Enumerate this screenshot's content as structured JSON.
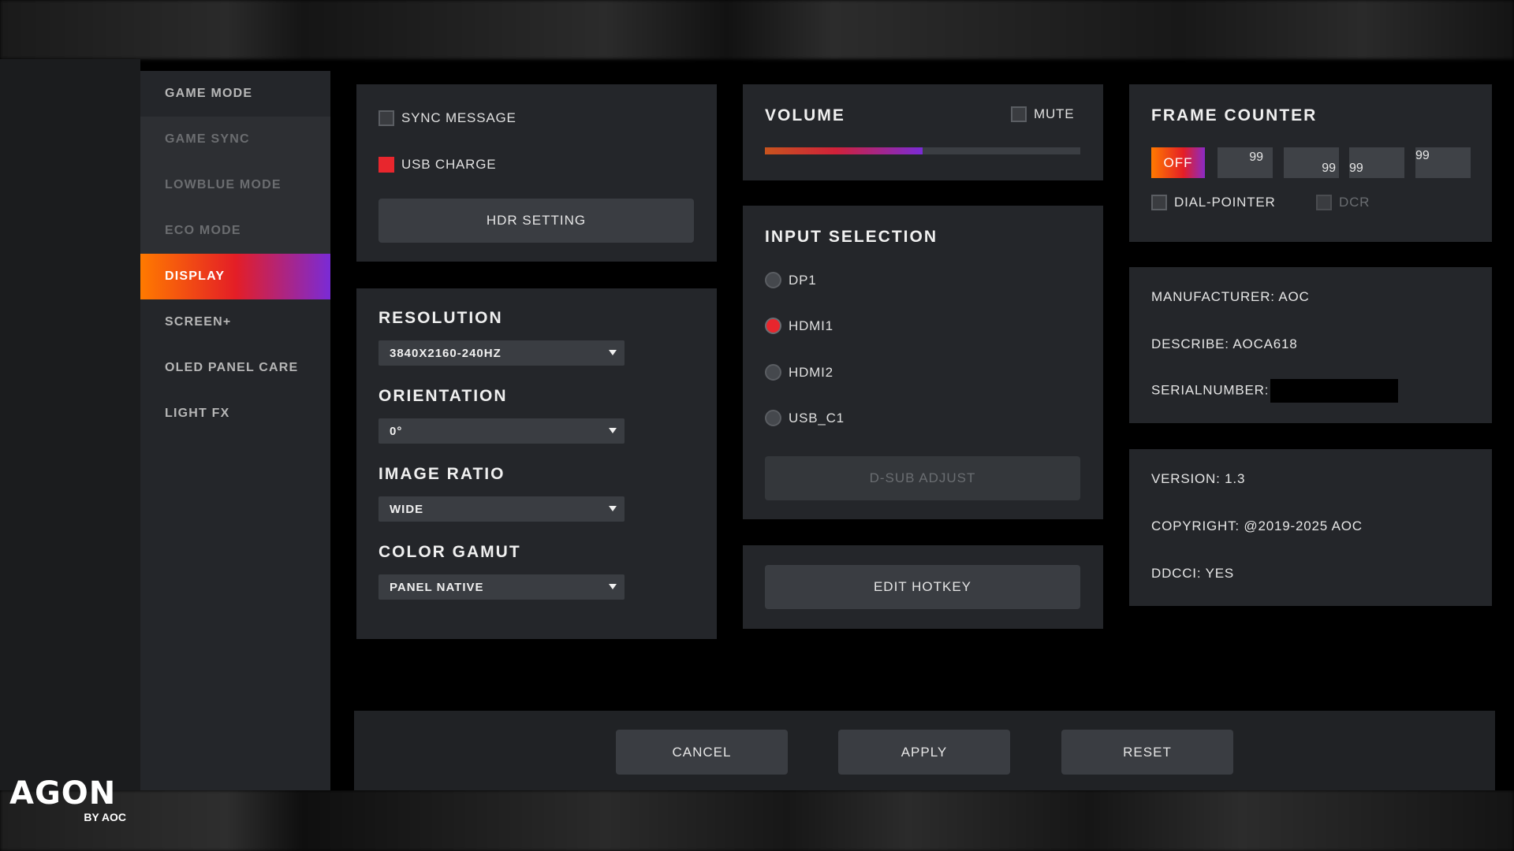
{
  "sidebar": {
    "items": [
      {
        "label": "GAME MODE"
      },
      {
        "label": "GAME SYNC"
      },
      {
        "label": "LOWBLUE MODE"
      },
      {
        "label": "ECO MODE"
      },
      {
        "label": "DISPLAY"
      },
      {
        "label": "SCREEN+"
      },
      {
        "label": "OLED PANEL CARE"
      },
      {
        "label": "LIGHT FX"
      }
    ],
    "active": "DISPLAY"
  },
  "logo": {
    "main": "AGON",
    "sub": "BY AOC"
  },
  "options": {
    "sync_message": {
      "label": "SYNC MESSAGE",
      "checked": false
    },
    "usb_charge": {
      "label": "USB CHARGE",
      "checked": true
    },
    "hdr_button": "HDR SETTING"
  },
  "display": {
    "resolution": {
      "label": "RESOLUTION",
      "value": "3840X2160-240HZ"
    },
    "orientation": {
      "label": "ORIENTATION",
      "value": "0°"
    },
    "image_ratio": {
      "label": "IMAGE RATIO",
      "value": "WIDE"
    },
    "color_gamut": {
      "label": "COLOR GAMUT",
      "value": "PANEL NATIVE"
    }
  },
  "volume": {
    "label": "VOLUME",
    "mute_label": "MUTE",
    "muted": false,
    "level_percent": 50
  },
  "input_selection": {
    "label": "INPUT SELECTION",
    "options": [
      "DP1",
      "HDMI1",
      "HDMI2",
      "USB_C1"
    ],
    "selected": "HDMI1",
    "dsub_button": "D-SUB ADJUST"
  },
  "hotkey": {
    "button": "EDIT HOTKEY"
  },
  "frame_counter": {
    "label": "FRAME COUNTER",
    "off_label": "OFF",
    "cells": [
      "99",
      "99",
      "99",
      "99"
    ],
    "dial_pointer": {
      "label": "DIAL-POINTER",
      "checked": false
    },
    "dcr": {
      "label": "DCR",
      "checked": false
    }
  },
  "device_info": {
    "manufacturer": "MANUFACTURER: AOC",
    "describe": "DESCRIBE: AOCA618",
    "serial_label": "SERIALNUMBER:"
  },
  "version_info": {
    "version": "VERSION: 1.3",
    "copyright": "COPYRIGHT: @2019-2025 AOC",
    "ddcci": "DDCCI: YES"
  },
  "footer": {
    "cancel": "CANCEL",
    "apply": "APPLY",
    "reset": "RESET"
  },
  "colors": {
    "accent_red": "#e8262d",
    "accent_orange": "#ff7a00",
    "accent_purple": "#7a2bd6",
    "panel": "#24262a"
  }
}
